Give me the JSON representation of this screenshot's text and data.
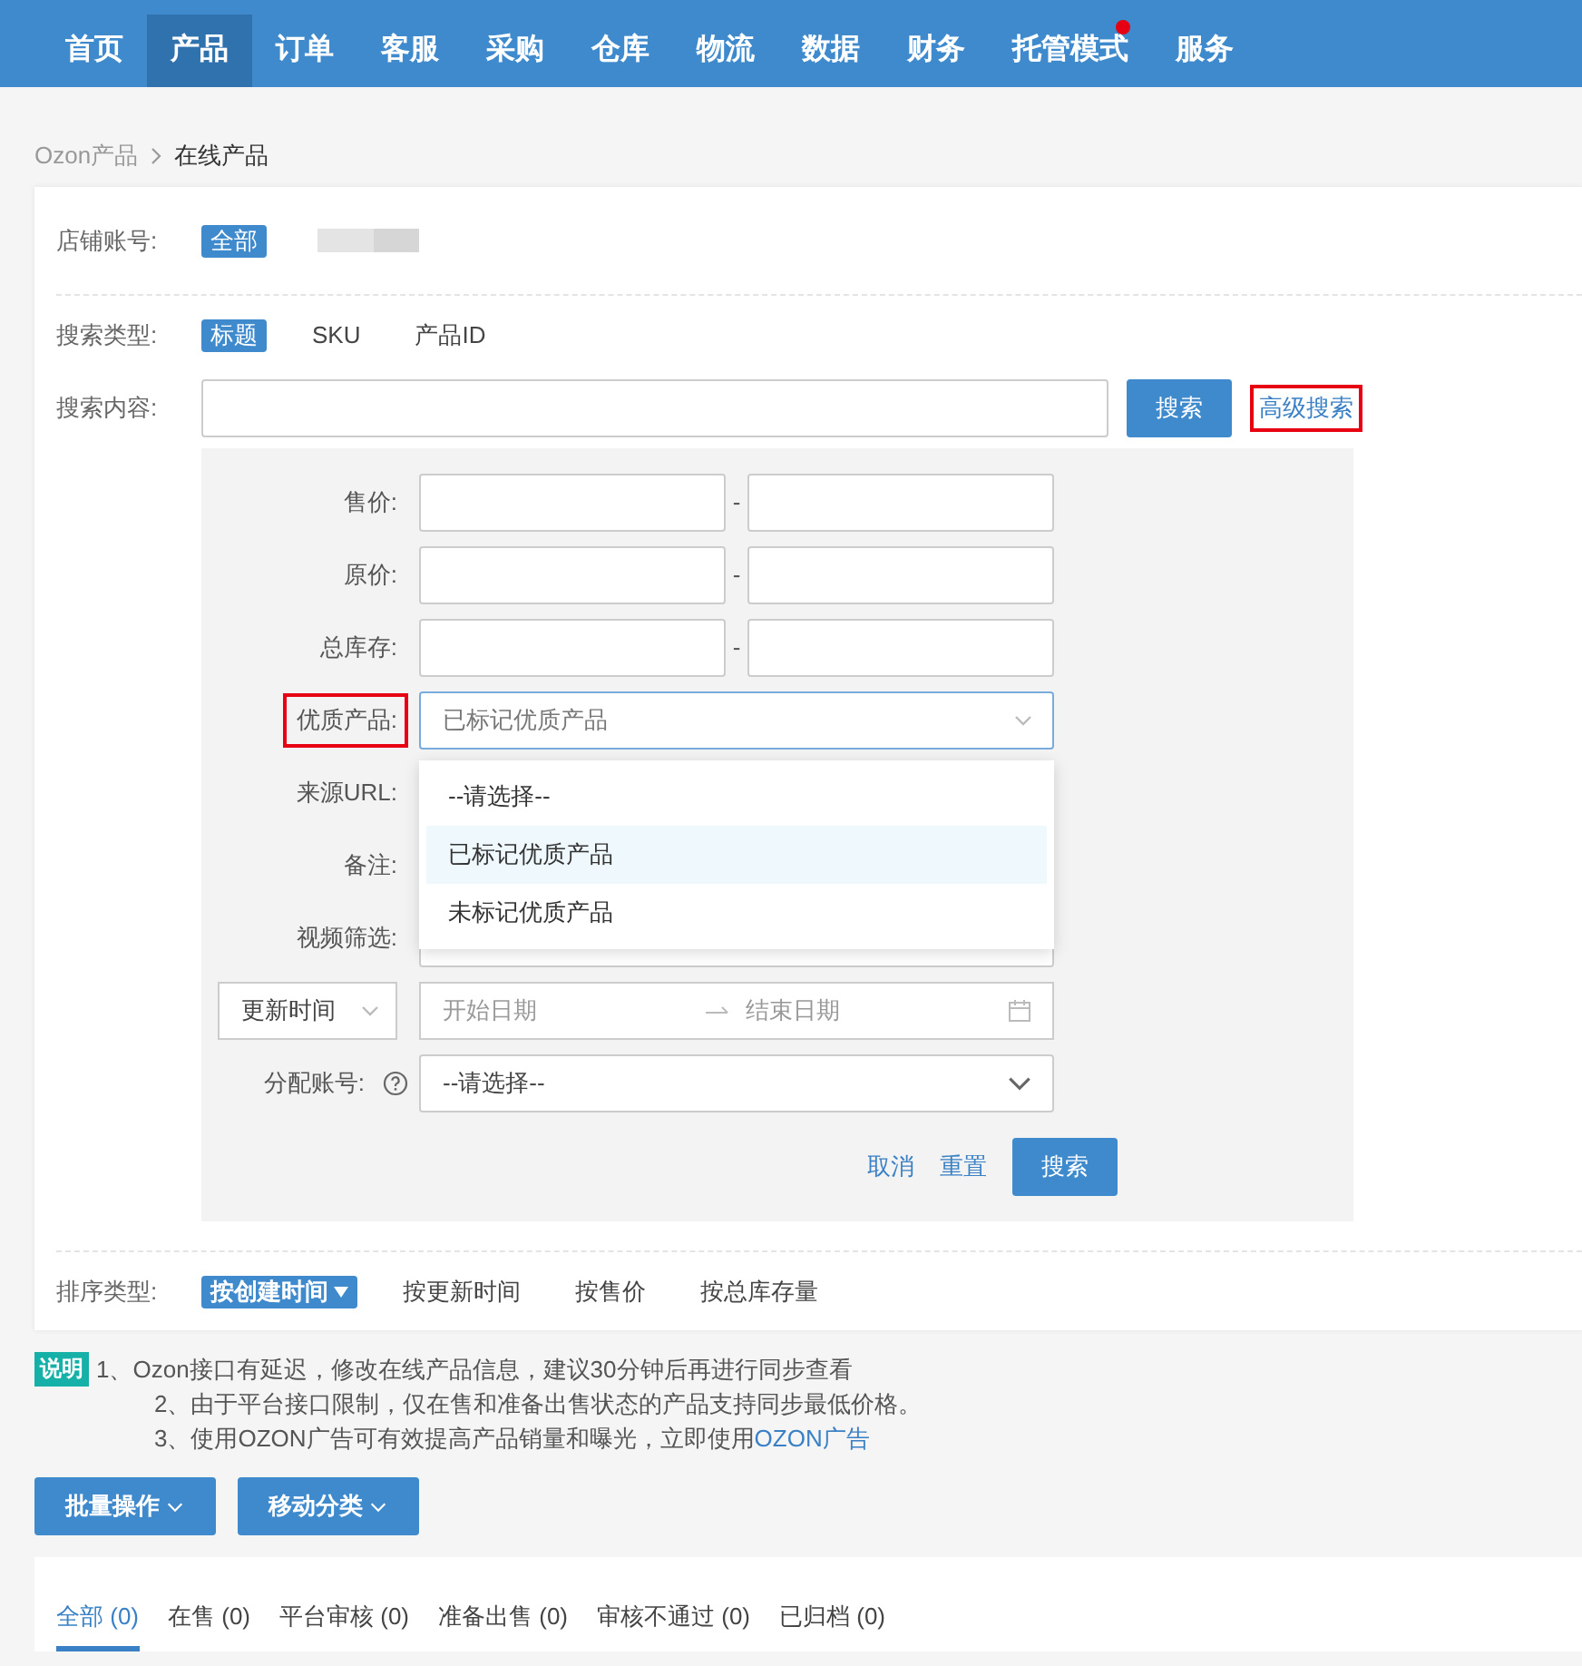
{
  "nav": {
    "items": [
      {
        "label": "首页",
        "selected": false,
        "notify": false
      },
      {
        "label": "产品",
        "selected": true,
        "notify": false
      },
      {
        "label": "订单",
        "selected": false,
        "notify": false
      },
      {
        "label": "客服",
        "selected": false,
        "notify": false
      },
      {
        "label": "采购",
        "selected": false,
        "notify": false
      },
      {
        "label": "仓库",
        "selected": false,
        "notify": false
      },
      {
        "label": "物流",
        "selected": false,
        "notify": false
      },
      {
        "label": "数据",
        "selected": false,
        "notify": false
      },
      {
        "label": "财务",
        "selected": false,
        "notify": false
      },
      {
        "label": "托管模式",
        "selected": false,
        "notify": true
      },
      {
        "label": "服务",
        "selected": false,
        "notify": false
      }
    ]
  },
  "breadcrumb": [
    "Ozon产品",
    "在线产品"
  ],
  "store": {
    "label": "店铺账号:",
    "options": [
      {
        "label": "全部",
        "selected": true
      }
    ]
  },
  "search_type": {
    "label": "搜索类型:",
    "options": [
      {
        "label": "标题",
        "selected": true
      },
      {
        "label": "SKU",
        "selected": false
      },
      {
        "label": "产品ID",
        "selected": false
      }
    ]
  },
  "search_content": {
    "label": "搜索内容:",
    "button": "搜索",
    "advanced_link": {
      "label": "高级搜索",
      "highlighted": true
    }
  },
  "advanced": {
    "rows": [
      {
        "kind": "range",
        "label": "售价:",
        "separator": "-"
      },
      {
        "kind": "range",
        "label": "原价:",
        "separator": "-"
      },
      {
        "kind": "range",
        "label": "总库存:",
        "separator": "-"
      },
      {
        "kind": "select",
        "label": "优质产品:",
        "value": "已标记优质产品",
        "highlighted": true,
        "expanded": true,
        "options": [
          {
            "label": "--请选择--",
            "selected": false
          },
          {
            "label": "已标记优质产品",
            "selected": true
          },
          {
            "label": "未标记优质产品",
            "selected": false
          }
        ]
      },
      {
        "kind": "covered",
        "label": "来源URL:"
      },
      {
        "kind": "covered",
        "label": "备注:"
      },
      {
        "kind": "partial",
        "label": "视频筛选:"
      },
      {
        "kind": "date_range",
        "selector": "更新时间",
        "start_placeholder": "开始日期",
        "end_placeholder": "结束日期"
      },
      {
        "kind": "select",
        "label": "分配账号:",
        "help": true,
        "value": "--请选择--",
        "highlighted": false,
        "expanded": false
      }
    ],
    "actions": {
      "cancel": "取消",
      "reset": "重置",
      "search": "搜索"
    }
  },
  "sort": {
    "label": "排序类型:",
    "options": [
      {
        "label": "按创建时间",
        "selected": true
      },
      {
        "label": "按更新时间",
        "selected": false
      },
      {
        "label": "按售价",
        "selected": false
      },
      {
        "label": "按总库存量",
        "selected": false
      }
    ]
  },
  "notes": {
    "badge": "说明",
    "lines": [
      {
        "text": "1、Ozon接口有延迟，修改在线产品信息，建议30分钟后再进行同步查看"
      },
      {
        "text": "2、由于平台接口限制，仅在售和准备出售状态的产品支持同步最低价格。"
      },
      {
        "text": "3、使用OZON广告可有效提高产品销量和曝光，立即使用",
        "link": "OZON广告"
      }
    ]
  },
  "bulk_buttons": [
    "批量操作",
    "移动分类"
  ],
  "status_tabs": [
    {
      "label": "全部 (0)",
      "selected": true
    },
    {
      "label": "在售 (0)",
      "selected": false
    },
    {
      "label": "平台审核 (0)",
      "selected": false
    },
    {
      "label": "准备出售 (0)",
      "selected": false
    },
    {
      "label": "审核不通过 (0)",
      "selected": false
    },
    {
      "label": "已归档 (0)",
      "selected": false
    }
  ]
}
